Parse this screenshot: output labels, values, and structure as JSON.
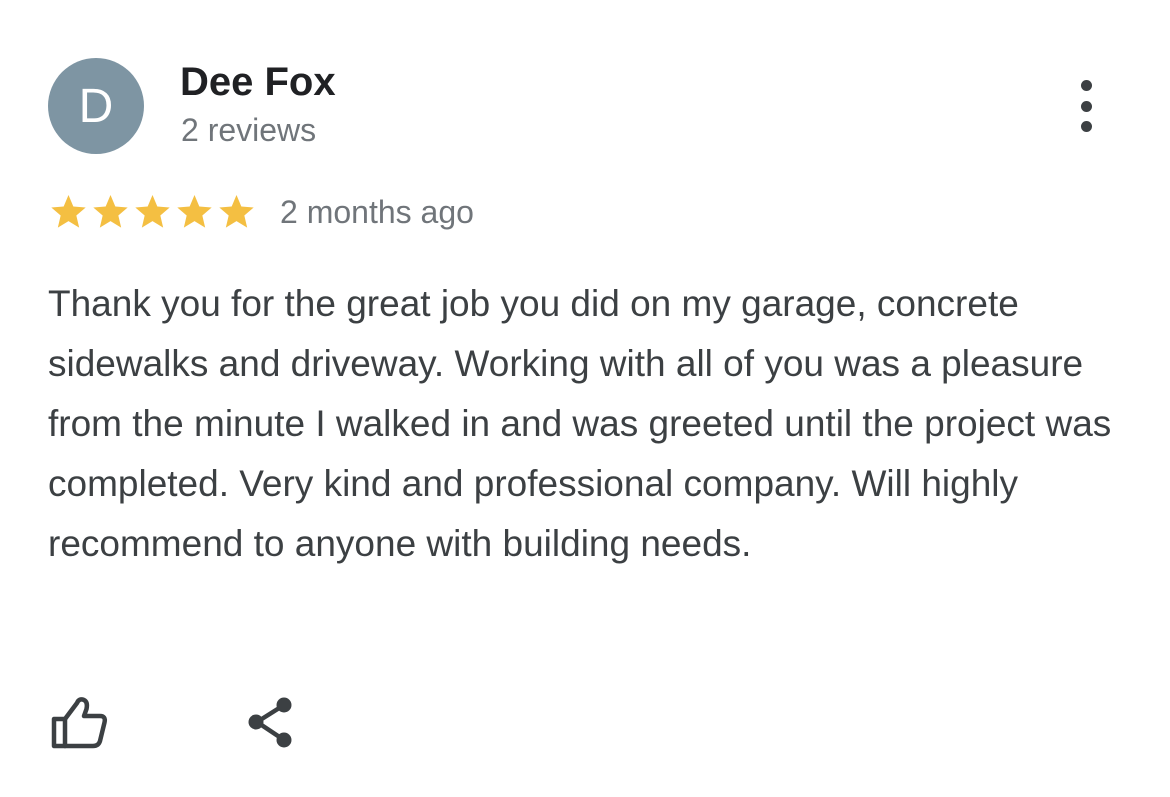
{
  "review": {
    "avatar_letter": "D",
    "avatar_color": "#7e95a3",
    "author_name": "Dee Fox",
    "review_count": "2 reviews",
    "rating": 5,
    "rating_max": 5,
    "star_color": "#f4bf42",
    "date": "2 months ago",
    "text": "Thank you for the great job you did on my garage, concrete sidewalks and driveway. Working with all of you was a pleasure from the minute I walked in and was greeted until the project was completed. Very kind and professional company. Will highly recommend to anyone with building needs."
  },
  "icons": {
    "menu": "more-vert-icon",
    "like": "thumbs-up-icon",
    "share": "share-icon",
    "star": "star-icon"
  }
}
